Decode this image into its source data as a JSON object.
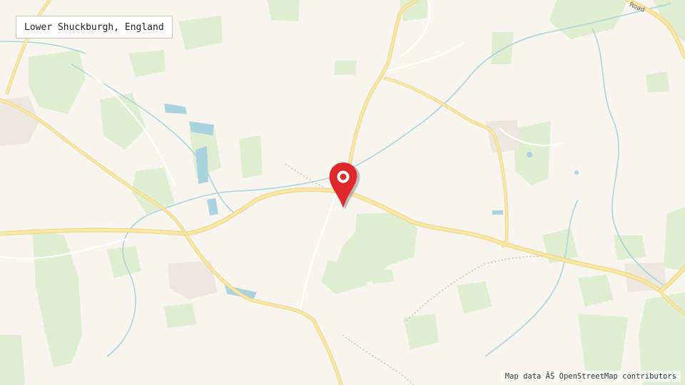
{
  "location_label": "Lower Shuckburgh, England",
  "attribution": "Map data ĂŠ OpenStreetMap contributors",
  "road_label": "Road",
  "marker": {
    "icon": "map-pin-icon",
    "color": "#e0282c"
  },
  "colors": {
    "land": "#f8f5ef",
    "woods": "#dfeed0",
    "roads": "#fbe6a2",
    "water": "#a9d3de"
  }
}
